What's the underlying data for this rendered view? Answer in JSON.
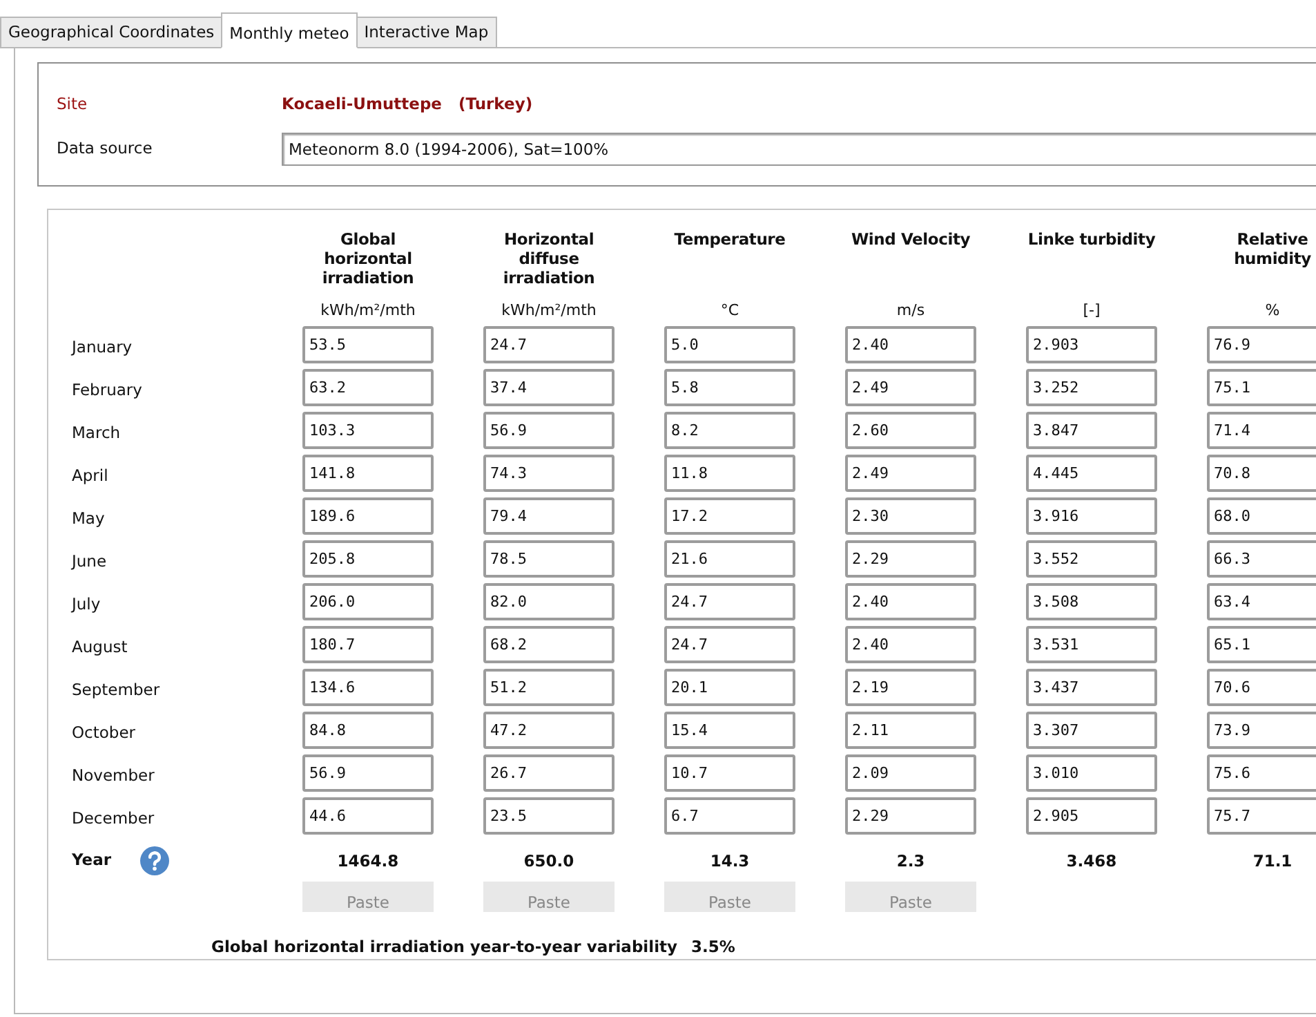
{
  "tabs": [
    {
      "label": "Geographical Coordinates",
      "selected": false
    },
    {
      "label": "Monthly meteo",
      "selected": true
    },
    {
      "label": "Interactive Map",
      "selected": false
    }
  ],
  "site": {
    "label": "Site",
    "value": "Kocaeli-Umuttepe   (Turkey)"
  },
  "data_source": {
    "label": "Data source",
    "value": "Meteonorm 8.0 (1994-2006), Sat=100%"
  },
  "table": {
    "columns": [
      {
        "title": "Global horizontal irradiation",
        "unit": "kWh/m²/mth"
      },
      {
        "title": "Horizontal diffuse irradiation",
        "unit": "kWh/m²/mth"
      },
      {
        "title": "Temperature",
        "unit": "°C"
      },
      {
        "title": "Wind Velocity",
        "unit": "m/s"
      },
      {
        "title": "Linke turbidity",
        "unit": "[-]"
      },
      {
        "title": "Relative humidity",
        "unit": "%"
      }
    ],
    "rows": [
      {
        "month": "January",
        "values": [
          "53.5",
          "24.7",
          "5.0",
          "2.40",
          "2.903",
          "76.9"
        ]
      },
      {
        "month": "February",
        "values": [
          "63.2",
          "37.4",
          "5.8",
          "2.49",
          "3.252",
          "75.1"
        ]
      },
      {
        "month": "March",
        "values": [
          "103.3",
          "56.9",
          "8.2",
          "2.60",
          "3.847",
          "71.4"
        ]
      },
      {
        "month": "April",
        "values": [
          "141.8",
          "74.3",
          "11.8",
          "2.49",
          "4.445",
          "70.8"
        ]
      },
      {
        "month": "May",
        "values": [
          "189.6",
          "79.4",
          "17.2",
          "2.30",
          "3.916",
          "68.0"
        ]
      },
      {
        "month": "June",
        "values": [
          "205.8",
          "78.5",
          "21.6",
          "2.29",
          "3.552",
          "66.3"
        ]
      },
      {
        "month": "July",
        "values": [
          "206.0",
          "82.0",
          "24.7",
          "2.40",
          "3.508",
          "63.4"
        ]
      },
      {
        "month": "August",
        "values": [
          "180.7",
          "68.2",
          "24.7",
          "2.40",
          "3.531",
          "65.1"
        ]
      },
      {
        "month": "September",
        "values": [
          "134.6",
          "51.2",
          "20.1",
          "2.19",
          "3.437",
          "70.6"
        ]
      },
      {
        "month": "October",
        "values": [
          "84.8",
          "47.2",
          "15.4",
          "2.11",
          "3.307",
          "73.9"
        ]
      },
      {
        "month": "November",
        "values": [
          "56.9",
          "26.7",
          "10.7",
          "2.09",
          "3.010",
          "75.6"
        ]
      },
      {
        "month": "December",
        "values": [
          "44.6",
          "23.5",
          "6.7",
          "2.29",
          "2.905",
          "75.7"
        ]
      }
    ],
    "year": {
      "label": "Year",
      "values": [
        "1464.8",
        "650.0",
        "14.3",
        "2.3",
        "3.468",
        "71.1"
      ]
    },
    "paste_buttons": [
      {
        "label": "Paste",
        "disabled": true
      },
      {
        "label": "Paste",
        "disabled": true
      },
      {
        "label": "Paste",
        "disabled": true
      },
      {
        "label": "Paste",
        "disabled": true
      }
    ]
  },
  "variability": {
    "label": "Global horizontal irradiation year-to-year variability",
    "value": "3.5%"
  }
}
